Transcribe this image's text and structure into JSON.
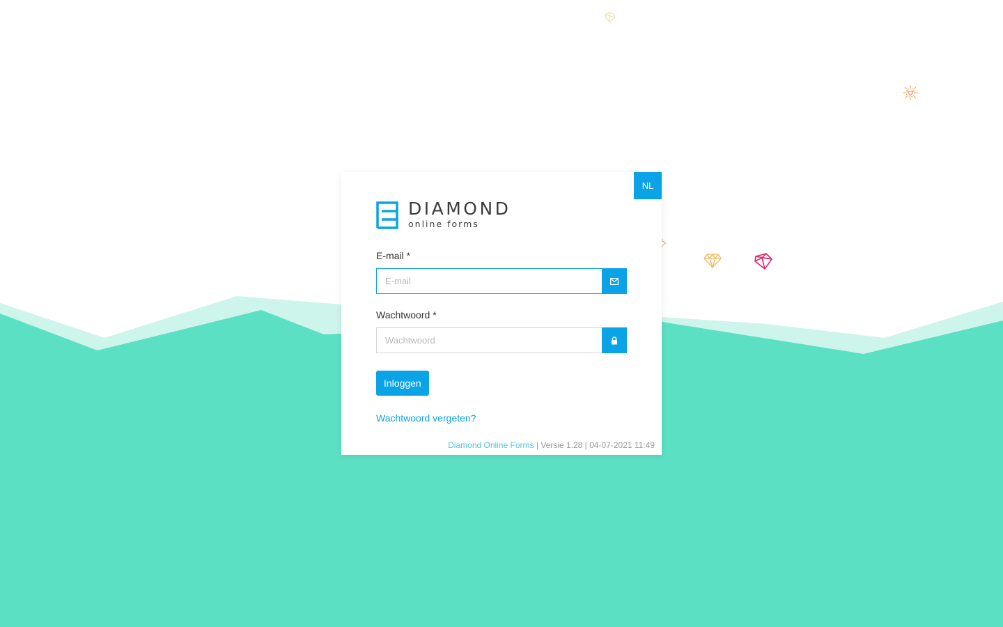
{
  "language": {
    "label": "NL"
  },
  "logo": {
    "title": "DIAMOND",
    "subtitle": "online forms"
  },
  "email": {
    "label": "E-mail",
    "required_mark": "*",
    "placeholder": "E-mail",
    "icon": "envelope-icon"
  },
  "password": {
    "label": "Wachtwoord",
    "required_mark": "*",
    "placeholder": "Wachtwoord",
    "icon": "lock-icon"
  },
  "login_button": {
    "label": "Inloggen"
  },
  "forgot_link": {
    "label": "Wachtwoord vergeten?"
  },
  "footer": {
    "product": "Diamond Online Forms",
    "info": "| Versie 1.28 | 04-07-2021 11:49"
  },
  "colors": {
    "accent": "#0aa4e6",
    "wave_dark": "#5ce0c4",
    "wave_light": "#cdf5eb",
    "gem_pink": "#e0246e",
    "gem_orange": "#f5b85a"
  }
}
